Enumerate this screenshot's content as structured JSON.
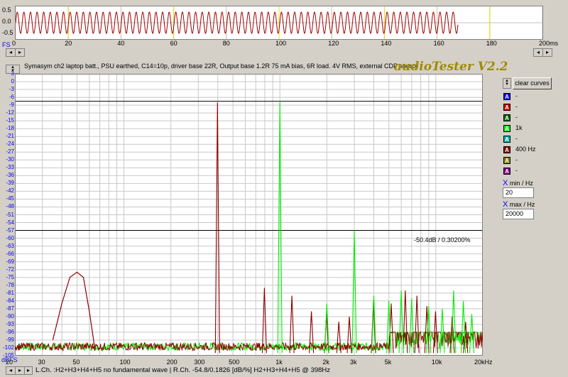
{
  "scope": {
    "y_labels": [
      "0.5",
      "0.0",
      "-0.5"
    ],
    "x_labels": [
      "0",
      "20",
      "40",
      "60",
      "80",
      "100",
      "120",
      "140",
      "160",
      "180",
      "200ms"
    ],
    "fs_label": "FS",
    "signal_color": "#a00000",
    "marker_color": "#e8e000",
    "cycles": 67,
    "signal_end_ms": 168
  },
  "header": {
    "subtitle": "Symasym ch2 laptop batt., PSU earthed, C14=10p, driver base 22R, Output base 1.2R 75 mA bias, 6R load. 4V RMS, external CDP source",
    "brand": "audioTester V2.2"
  },
  "plot": {
    "db_labels": [
      "3",
      "0",
      "-3",
      "-6",
      "-9",
      "-12",
      "-15",
      "-18",
      "-21",
      "-24",
      "-27",
      "-30",
      "-33",
      "-36",
      "-39",
      "-42",
      "-45",
      "-48",
      "-51",
      "-54",
      "-57",
      "-60",
      "-63",
      "-66",
      "-69",
      "-72",
      "-75",
      "-78",
      "-81",
      "-84",
      "-87",
      "-90",
      "-93",
      "-96",
      "-99",
      "-102",
      "-105"
    ],
    "dbfs_label": "dBFS",
    "freq_labels": [
      {
        "f": 20,
        "t": "20"
      },
      {
        "f": 30,
        "t": "30"
      },
      {
        "f": 50,
        "t": "50"
      },
      {
        "f": 100,
        "t": "100"
      },
      {
        "f": 200,
        "t": "200"
      },
      {
        "f": 300,
        "t": "300"
      },
      {
        "f": 500,
        "t": "500"
      },
      {
        "f": 1000,
        "t": "1k"
      },
      {
        "f": 2000,
        "t": "2k"
      },
      {
        "f": 3000,
        "t": "3k"
      },
      {
        "f": 5000,
        "t": "5k"
      },
      {
        "f": 10000,
        "t": "10k"
      },
      {
        "f": 20000,
        "t": "20kHz"
      }
    ],
    "annotation": "-50.4dB  /  0.30200%",
    "ref_lines_db": [
      -7.5,
      -57
    ],
    "db_min": -105,
    "db_max": 3,
    "f_min": 20,
    "f_max": 20000
  },
  "curves": {
    "red": {
      "color": "#8b0000",
      "fundamental": {
        "f": 398,
        "db": -8
      },
      "harmonics": [
        {
          "f": 796,
          "db": -79
        },
        {
          "f": 1194,
          "db": -82
        },
        {
          "f": 1592,
          "db": -88
        },
        {
          "f": 1990,
          "db": -89
        },
        {
          "f": 2388,
          "db": -92
        },
        {
          "f": 2786,
          "db": -90
        },
        {
          "f": 3980,
          "db": -84
        },
        {
          "f": 5174,
          "db": -85
        },
        {
          "f": 6368,
          "db": -80
        },
        {
          "f": 7562,
          "db": -82
        },
        {
          "f": 8756,
          "db": -86
        },
        {
          "f": 9950,
          "db": -88
        },
        {
          "f": 12736,
          "db": -90
        },
        {
          "f": 15522,
          "db": -92
        }
      ],
      "hum_bump": [
        {
          "f": 35,
          "db": -99
        },
        {
          "f": 40,
          "db": -85
        },
        {
          "f": 45,
          "db": -75
        },
        {
          "f": 50,
          "db": -73
        },
        {
          "f": 55,
          "db": -75
        },
        {
          "f": 60,
          "db": -88
        },
        {
          "f": 65,
          "db": -102
        }
      ]
    },
    "green": {
      "color": "#00ee00",
      "fundamental": {
        "f": 1000,
        "db": -8
      },
      "harmonics": [
        {
          "f": 3000,
          "db": -57
        },
        {
          "f": 2000,
          "db": -85
        },
        {
          "f": 4000,
          "db": -82
        },
        {
          "f": 5000,
          "db": -84
        },
        {
          "f": 6000,
          "db": -80
        },
        {
          "f": 7000,
          "db": -83
        },
        {
          "f": 9000,
          "db": -86
        },
        {
          "f": 11000,
          "db": -87
        },
        {
          "f": 13000,
          "db": -80
        },
        {
          "f": 15000,
          "db": -84
        },
        {
          "f": 17000,
          "db": -89
        }
      ]
    }
  },
  "legend": {
    "items": [
      {
        "letter": "A",
        "color": "#0000ff",
        "label": "-"
      },
      {
        "letter": "A",
        "color": "#cc0000",
        "label": "-"
      },
      {
        "letter": "A",
        "color": "#006400",
        "label": "-"
      },
      {
        "letter": "A",
        "color": "#00ee00",
        "label": "1k"
      },
      {
        "letter": "A",
        "color": "#00b0b0",
        "label": "-"
      },
      {
        "letter": "A",
        "color": "#8b0000",
        "label": "400 Hz"
      },
      {
        "letter": "A",
        "color": "#808000",
        "label": "-"
      },
      {
        "letter": "A",
        "color": "#800080",
        "label": "-"
      }
    ],
    "clear_button": "clear curves",
    "xmin_label": "min / Hz",
    "xmin_value": "20",
    "xmax_label": "max / Hz",
    "xmax_value": "20000",
    "x_glyph": "X"
  },
  "status": {
    "text": "L.Ch. :H2+H3+H4+H5 no fundamental wave  |  R.Ch.  -54.8/0.1826  [dB/%]  H2+H3+H4+H5 @ 398Hz"
  }
}
